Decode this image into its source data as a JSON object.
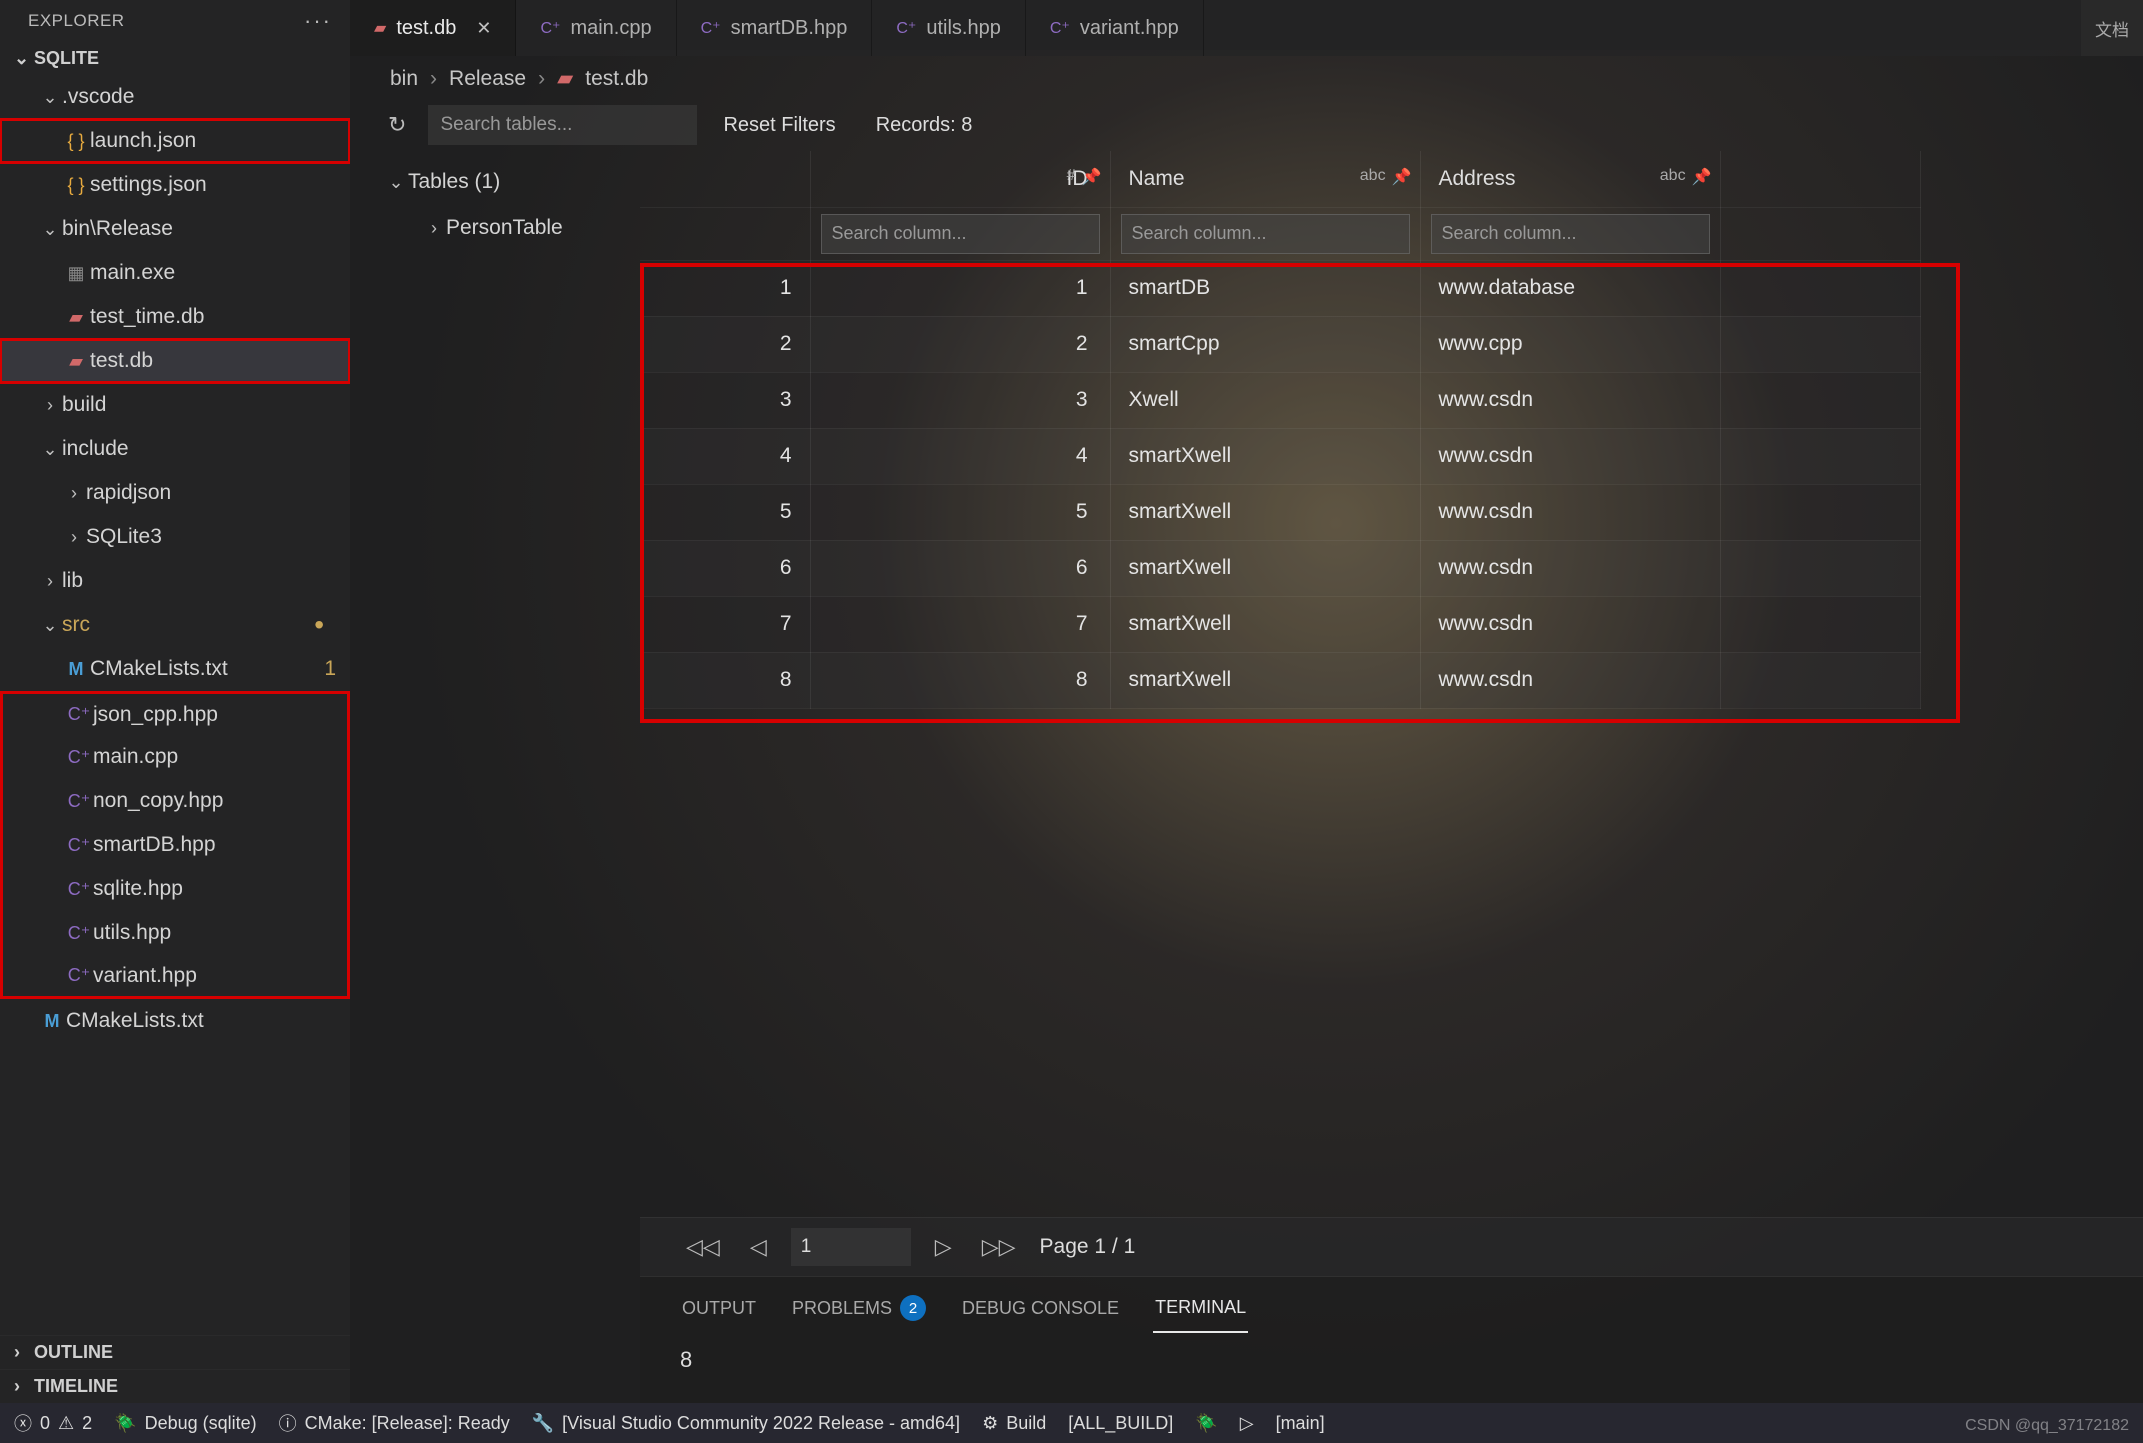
{
  "sidebar": {
    "title": "EXPLORER",
    "section": "SQLITE",
    "tree": [
      {
        "type": "folder",
        "open": true,
        "depth": 1,
        "label": ".vscode"
      },
      {
        "type": "file",
        "icon": "json",
        "depth": 2,
        "label": "launch.json",
        "red": true
      },
      {
        "type": "file",
        "icon": "json",
        "depth": 2,
        "label": "settings.json"
      },
      {
        "type": "folder",
        "open": true,
        "depth": 1,
        "label": "bin\\Release"
      },
      {
        "type": "file",
        "icon": "bar",
        "depth": 2,
        "label": "main.exe"
      },
      {
        "type": "file",
        "icon": "db",
        "depth": 2,
        "label": "test_time.db"
      },
      {
        "type": "file",
        "icon": "db",
        "depth": 2,
        "label": "test.db",
        "sel": true,
        "red": true
      },
      {
        "type": "folder",
        "open": false,
        "depth": 1,
        "label": "build"
      },
      {
        "type": "folder",
        "open": true,
        "depth": 1,
        "label": "include"
      },
      {
        "type": "folder",
        "open": false,
        "depth": 2,
        "label": "rapidjson"
      },
      {
        "type": "folder",
        "open": false,
        "depth": 2,
        "label": "SQLite3"
      },
      {
        "type": "folder",
        "open": false,
        "depth": 1,
        "label": "lib"
      },
      {
        "type": "folder",
        "open": true,
        "depth": 1,
        "label": "src",
        "mod": true
      },
      {
        "type": "file",
        "icon": "m",
        "depth": 2,
        "label": "CMakeLists.txt",
        "badge": "1"
      },
      {
        "type": "file",
        "icon": "cpp",
        "depth": 2,
        "label": "json_cpp.hpp",
        "redstart": true
      },
      {
        "type": "file",
        "icon": "cpp",
        "depth": 2,
        "label": "main.cpp"
      },
      {
        "type": "file",
        "icon": "cpp",
        "depth": 2,
        "label": "non_copy.hpp"
      },
      {
        "type": "file",
        "icon": "cpp",
        "depth": 2,
        "label": "smartDB.hpp"
      },
      {
        "type": "file",
        "icon": "cpp",
        "depth": 2,
        "label": "sqlite.hpp"
      },
      {
        "type": "file",
        "icon": "cpp",
        "depth": 2,
        "label": "utils.hpp"
      },
      {
        "type": "file",
        "icon": "cpp",
        "depth": 2,
        "label": "variant.hpp",
        "redend": true
      },
      {
        "type": "file",
        "icon": "m",
        "depth": 1,
        "label": "CMakeLists.txt"
      }
    ],
    "outline": "OUTLINE",
    "timeline": "TIMELINE"
  },
  "tabs": [
    {
      "icon": "db",
      "label": "test.db",
      "active": true,
      "close": true
    },
    {
      "icon": "cpp",
      "label": "main.cpp"
    },
    {
      "icon": "cpp",
      "label": "smartDB.hpp"
    },
    {
      "icon": "cpp",
      "label": "utils.hpp"
    },
    {
      "icon": "cpp",
      "label": "variant.hpp"
    }
  ],
  "tab_extra": "文档",
  "breadcrumbs": [
    "bin",
    "Release",
    "test.db"
  ],
  "toolbar": {
    "search_placeholder": "Search tables...",
    "reset": "Reset Filters",
    "records": "Records: 8"
  },
  "tables": {
    "header": "Tables (1)",
    "items": [
      "PersonTable"
    ]
  },
  "grid": {
    "columns": [
      "ID",
      "Name",
      "Address"
    ],
    "filter_placeholder": "Search column...",
    "rows": [
      {
        "n": "1",
        "id": "1",
        "name": "smartDB",
        "addr": "www.database"
      },
      {
        "n": "2",
        "id": "2",
        "name": "smartCpp",
        "addr": "www.cpp"
      },
      {
        "n": "3",
        "id": "3",
        "name": "Xwell",
        "addr": "www.csdn"
      },
      {
        "n": "4",
        "id": "4",
        "name": "smartXwell",
        "addr": "www.csdn"
      },
      {
        "n": "5",
        "id": "5",
        "name": "smartXwell",
        "addr": "www.csdn"
      },
      {
        "n": "6",
        "id": "6",
        "name": "smartXwell",
        "addr": "www.csdn"
      },
      {
        "n": "7",
        "id": "7",
        "name": "smartXwell",
        "addr": "www.csdn"
      },
      {
        "n": "8",
        "id": "8",
        "name": "smartXwell",
        "addr": "www.csdn"
      }
    ]
  },
  "pager": {
    "value": "1",
    "text": "Page 1 / 1"
  },
  "panel": {
    "tabs": {
      "output": "OUTPUT",
      "problems": "PROBLEMS",
      "problems_count": "2",
      "debug": "DEBUG CONSOLE",
      "terminal": "TERMINAL"
    },
    "terminal_out": "8"
  },
  "status": {
    "errors": "0",
    "warnings": "2",
    "debug": "Debug (sqlite)",
    "cmake": "CMake: [Release]: Ready",
    "kit": "[Visual Studio Community 2022 Release - amd64]",
    "build": "Build",
    "all": "[ALL_BUILD]",
    "branch": "[main]"
  },
  "watermark": "CSDN @qq_37172182"
}
